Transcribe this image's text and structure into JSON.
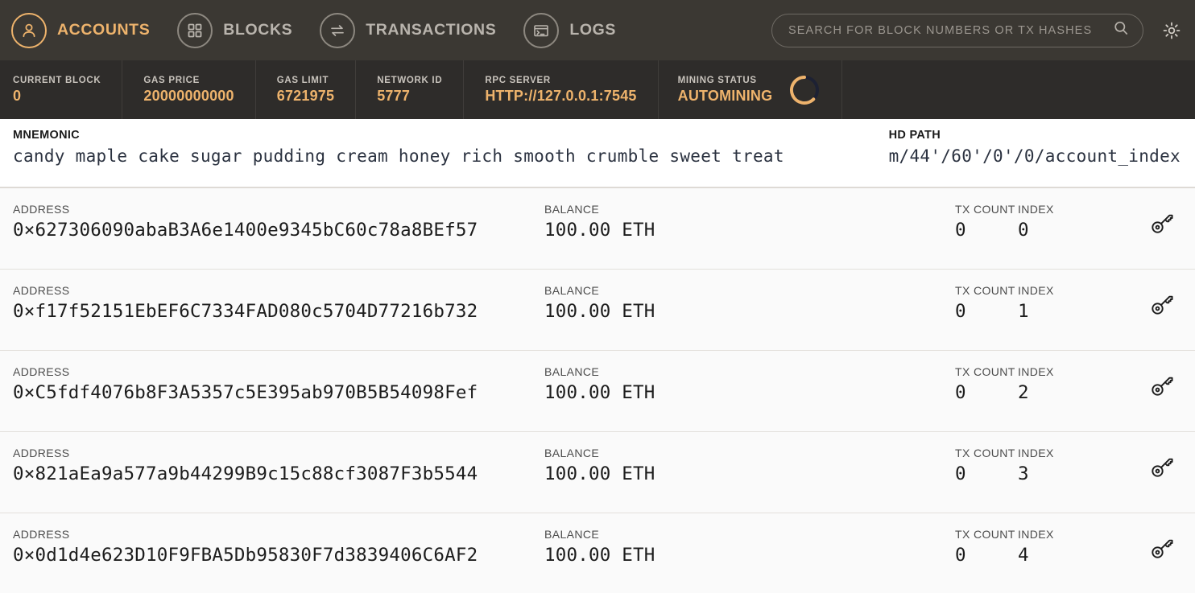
{
  "nav": {
    "items": [
      {
        "label": "ACCOUNTS",
        "icon": "user-icon",
        "active": true
      },
      {
        "label": "BLOCKS",
        "icon": "grid-blocks-icon",
        "active": false
      },
      {
        "label": "TRANSACTIONS",
        "icon": "transfer-arrows-icon",
        "active": false
      },
      {
        "label": "LOGS",
        "icon": "terminal-window-icon",
        "active": false
      }
    ],
    "search_placeholder": "SEARCH FOR BLOCK NUMBERS OR TX HASHES",
    "search_value": "",
    "settings_icon": "gear-icon"
  },
  "status": {
    "current_block": {
      "label": "CURRENT BLOCK",
      "value": "0"
    },
    "gas_price": {
      "label": "GAS PRICE",
      "value": "20000000000"
    },
    "gas_limit": {
      "label": "GAS LIMIT",
      "value": "6721975"
    },
    "network_id": {
      "label": "NETWORK ID",
      "value": "5777"
    },
    "rpc_server": {
      "label": "RPC SERVER",
      "value": "HTTP://127.0.0.1:7545"
    },
    "mining_status": {
      "label": "MINING STATUS",
      "value": "AUTOMINING"
    }
  },
  "mnemonic": {
    "label": "MNEMONIC",
    "value": "candy maple cake sugar pudding cream honey rich smooth crumble sweet treat"
  },
  "hdpath": {
    "label": "HD PATH",
    "value": "m/44'/60'/0'/0/account_index"
  },
  "labels": {
    "address": "ADDRESS",
    "balance": "BALANCE",
    "tx_count": "TX COUNT",
    "index": "INDEX",
    "key_icon": "key-icon"
  },
  "accounts": [
    {
      "address": "0×627306090abaB3A6e1400e9345bC60c78a8BEf57",
      "balance": "100.00 ETH",
      "tx_count": "0",
      "index": "0"
    },
    {
      "address": "0×f17f52151EbEF6C7334FAD080c5704D77216b732",
      "balance": "100.00 ETH",
      "tx_count": "0",
      "index": "1"
    },
    {
      "address": "0×C5fdf4076b8F3A5357c5E395ab970B5B54098Fef",
      "balance": "100.00 ETH",
      "tx_count": "0",
      "index": "2"
    },
    {
      "address": "0×821aEa9a577a9b44299B9c15c88cf3087F3b5544",
      "balance": "100.00 ETH",
      "tx_count": "0",
      "index": "3"
    },
    {
      "address": "0×0d1d4e623D10F9FBA5Db95830F7d3839406C6AF2",
      "balance": "100.00 ETH",
      "tx_count": "0",
      "index": "4"
    }
  ],
  "colors": {
    "accent": "#eeb36c",
    "topbar_bg": "#3b3833",
    "statusbar_bg": "#2e2c2a",
    "page_bg": "#fafafa"
  }
}
